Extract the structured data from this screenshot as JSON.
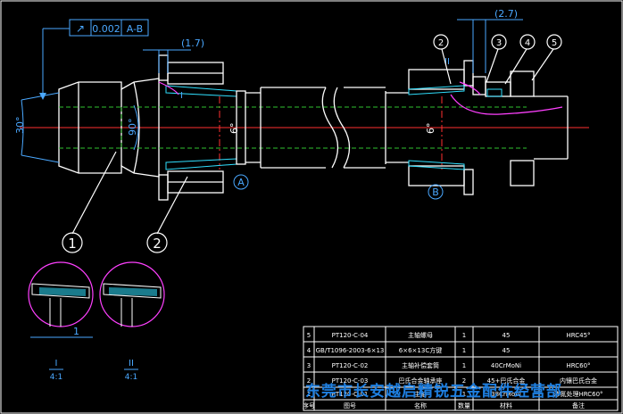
{
  "drawing": {
    "tolerance": {
      "symbol": "↗",
      "value": "0.002",
      "datum": "A-B"
    },
    "dims": {
      "d1": "(1.7)",
      "d2": "(2.7)",
      "ang30": "30°",
      "ang90": "90°",
      "ang6a": "6°",
      "ang6b": "6°",
      "dim1": "1"
    },
    "datums": {
      "a": "A",
      "b": "B"
    },
    "callouts": [
      "1",
      "2",
      "2",
      "3",
      "4",
      "5"
    ],
    "markers": {
      "i": "I",
      "ii": "II"
    },
    "details": [
      {
        "roman": "I",
        "scale": "4:1"
      },
      {
        "roman": "II",
        "scale": "4:1"
      }
    ]
  },
  "bom": {
    "rows": [
      {
        "no": "5",
        "code": "PT120-C-04",
        "name": "主轴螺母",
        "qty": "1",
        "material": "45",
        "note": "HRC45°"
      },
      {
        "no": "4",
        "code": "GB/T1096-2003-6×13",
        "name": "6×6×13C方键",
        "qty": "1",
        "material": "45",
        "note": ""
      },
      {
        "no": "3",
        "code": "PT120-C-02",
        "name": "主轴补偿套筒",
        "qty": "1",
        "material": "40CrMoNi",
        "note": "HRC60°"
      },
      {
        "no": "2",
        "code": "PT120-C-03",
        "name": "巴氏合金轴承座",
        "qty": "2",
        "material": "45+巴氏合金",
        "note": "内镶巴氏合金"
      },
      {
        "no": "1",
        "code": "PT120-C-01",
        "name": "主轴",
        "qty": "1",
        "material": "38CrMoAl",
        "note": "渗氮处理HRC60°"
      }
    ],
    "header": {
      "no": "序号",
      "code": "图号",
      "name": "名称",
      "qty": "数量",
      "material": "材料",
      "note": "备注"
    }
  },
  "watermark": "东莞市长安越启精锐五金配件经营部",
  "colors": {
    "line": "#ffffff",
    "center": "#ff3030",
    "hidden": "#2fc22f",
    "blue": "#4aa8ff",
    "magenta": "#ff40ff",
    "yellow": "#ffff30",
    "cyan": "#30e0ff"
  }
}
